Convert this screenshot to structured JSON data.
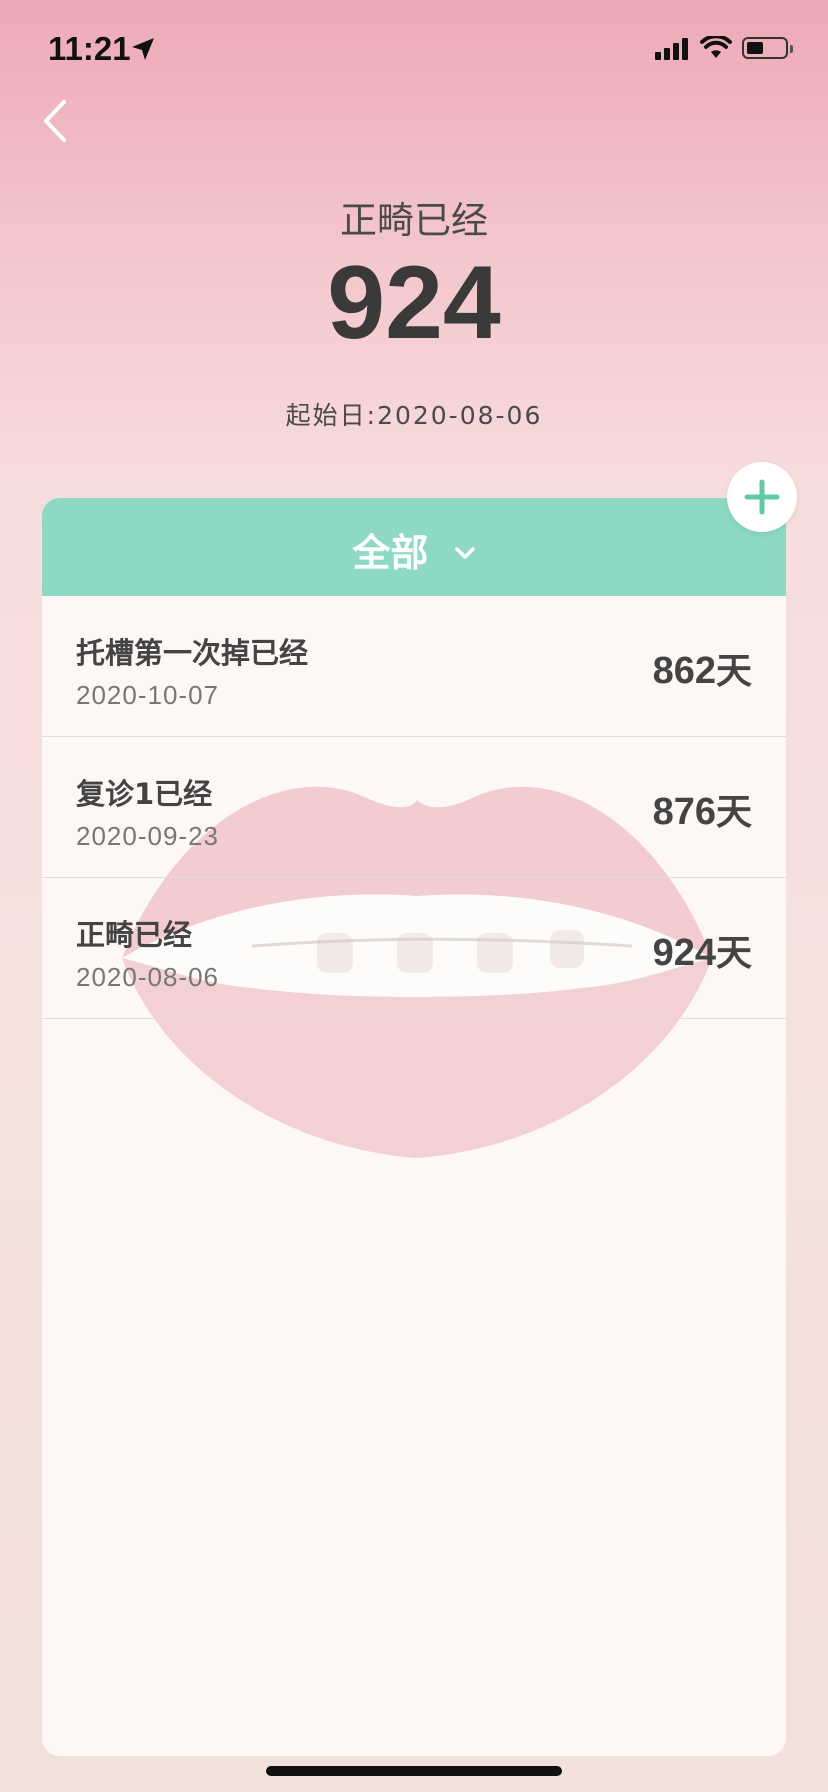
{
  "status": {
    "time": "11:21"
  },
  "header": {
    "title": "正畸已经",
    "days": "924",
    "start_label": "起始日:",
    "start_date": "2020-08-06"
  },
  "filter": {
    "label": "全部"
  },
  "items": [
    {
      "name": "托槽第一次掉已经",
      "date": "2020-10-07",
      "days": "862",
      "unit": "天"
    },
    {
      "name": "复诊1已经",
      "date": "2020-09-23",
      "days": "876",
      "unit": "天"
    },
    {
      "name": "正畸已经",
      "date": "2020-08-06",
      "days": "924",
      "unit": "天"
    }
  ],
  "colors": {
    "accent": "#8ed9c3",
    "add_plus": "#5fc9a8",
    "text_dark": "#3f3f3f"
  },
  "icons": {
    "back": "chevron-left-icon",
    "add": "plus-icon",
    "filter": "chevron-down-icon",
    "location": "location-arrow-icon",
    "signal": "cellular-signal-icon",
    "wifi": "wifi-icon",
    "battery": "battery-icon"
  }
}
